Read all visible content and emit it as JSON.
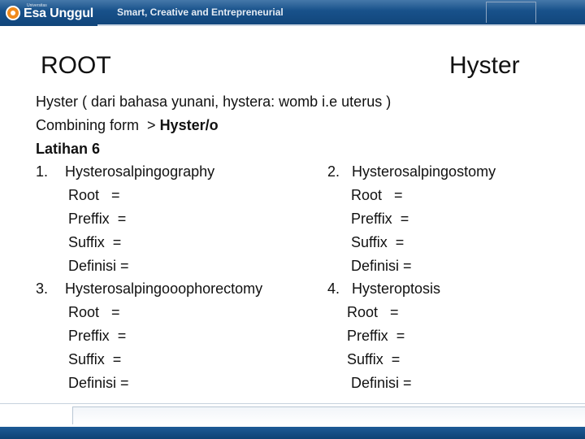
{
  "header": {
    "brand": "Esa Unggul",
    "brand_small": "Universitas",
    "tagline": "Smart, Creative and Entrepreneurial",
    "band_color": "#1a5592",
    "logo_color": "#f08a1c"
  },
  "slide": {
    "title_left": "ROOT",
    "title_right": "Hyster",
    "intro": "Hyster ( dari bahasa yunani, hystera: womb i.e uterus )",
    "combining_prefix": "Combining form  > ",
    "combining_bold": "Hyster/o",
    "exercise": "Latihan 6",
    "items": [
      {
        "number": "1.",
        "term": "Hysterosalpingography",
        "root": "Root   =",
        "prefix": "Preffix  =",
        "suffix": "Suffix  =",
        "definition": "Definisi ="
      },
      {
        "number": "2.",
        "term": "Hysterosalpingostomy",
        "root": "Root   =",
        "prefix": "Preffix  =",
        "suffix": "Suffix  =",
        "definition": "Definisi ="
      },
      {
        "number": "3.",
        "term": "Hysterosalpingooophorectomy",
        "root": "Root   =",
        "prefix": "Preffix  =",
        "suffix": "Suffix  =",
        "definition": "Definisi ="
      },
      {
        "number": "4.",
        "term": "Hysteroptosis",
        "root": "Root   =",
        "prefix": "Preffix  =",
        "suffix": "Suffix  =",
        "definition": "Definisi ="
      }
    ]
  }
}
